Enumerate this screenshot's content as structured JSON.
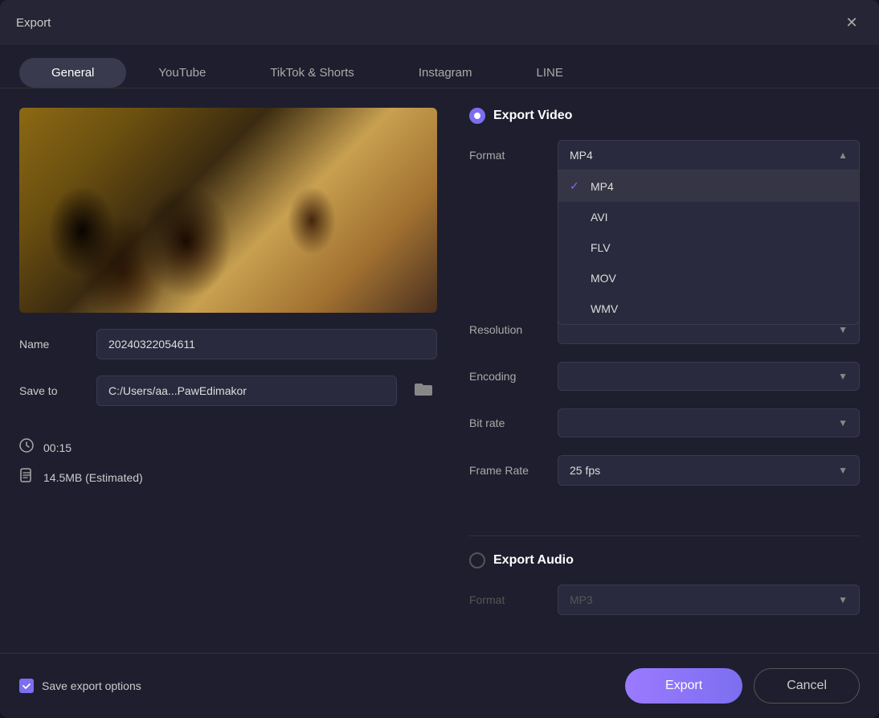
{
  "dialog": {
    "title": "Export",
    "close_label": "✕"
  },
  "tabs": [
    {
      "id": "general",
      "label": "General",
      "active": true
    },
    {
      "id": "youtube",
      "label": "YouTube",
      "active": false
    },
    {
      "id": "tiktok",
      "label": "TikTok & Shorts",
      "active": false
    },
    {
      "id": "instagram",
      "label": "Instagram",
      "active": false
    },
    {
      "id": "line",
      "label": "LINE",
      "active": false
    }
  ],
  "left": {
    "name_label": "Name",
    "name_value": "20240322054611",
    "save_to_label": "Save to",
    "save_to_value": "C:/Users/aa...PawEdimakor",
    "duration_label": "00:15",
    "size_label": "14.5MB (Estimated)"
  },
  "right": {
    "export_video_label": "Export Video",
    "export_video_checked": true,
    "format_label": "Format",
    "format_value": "MP4",
    "format_open": true,
    "format_options": [
      {
        "value": "MP4",
        "selected": true
      },
      {
        "value": "AVI",
        "selected": false
      },
      {
        "value": "FLV",
        "selected": false
      },
      {
        "value": "MOV",
        "selected": false
      },
      {
        "value": "WMV",
        "selected": false
      }
    ],
    "resolution_label": "Resolution",
    "encoding_label": "Encoding",
    "bit_rate_label": "Bit rate",
    "frame_rate_label": "Frame Rate",
    "frame_rate_value": "25  fps",
    "export_audio_label": "Export Audio",
    "export_audio_checked": false,
    "audio_format_label": "Format",
    "audio_format_value": "MP3"
  },
  "footer": {
    "save_export_label": "Save export options",
    "export_button": "Export",
    "cancel_button": "Cancel"
  }
}
